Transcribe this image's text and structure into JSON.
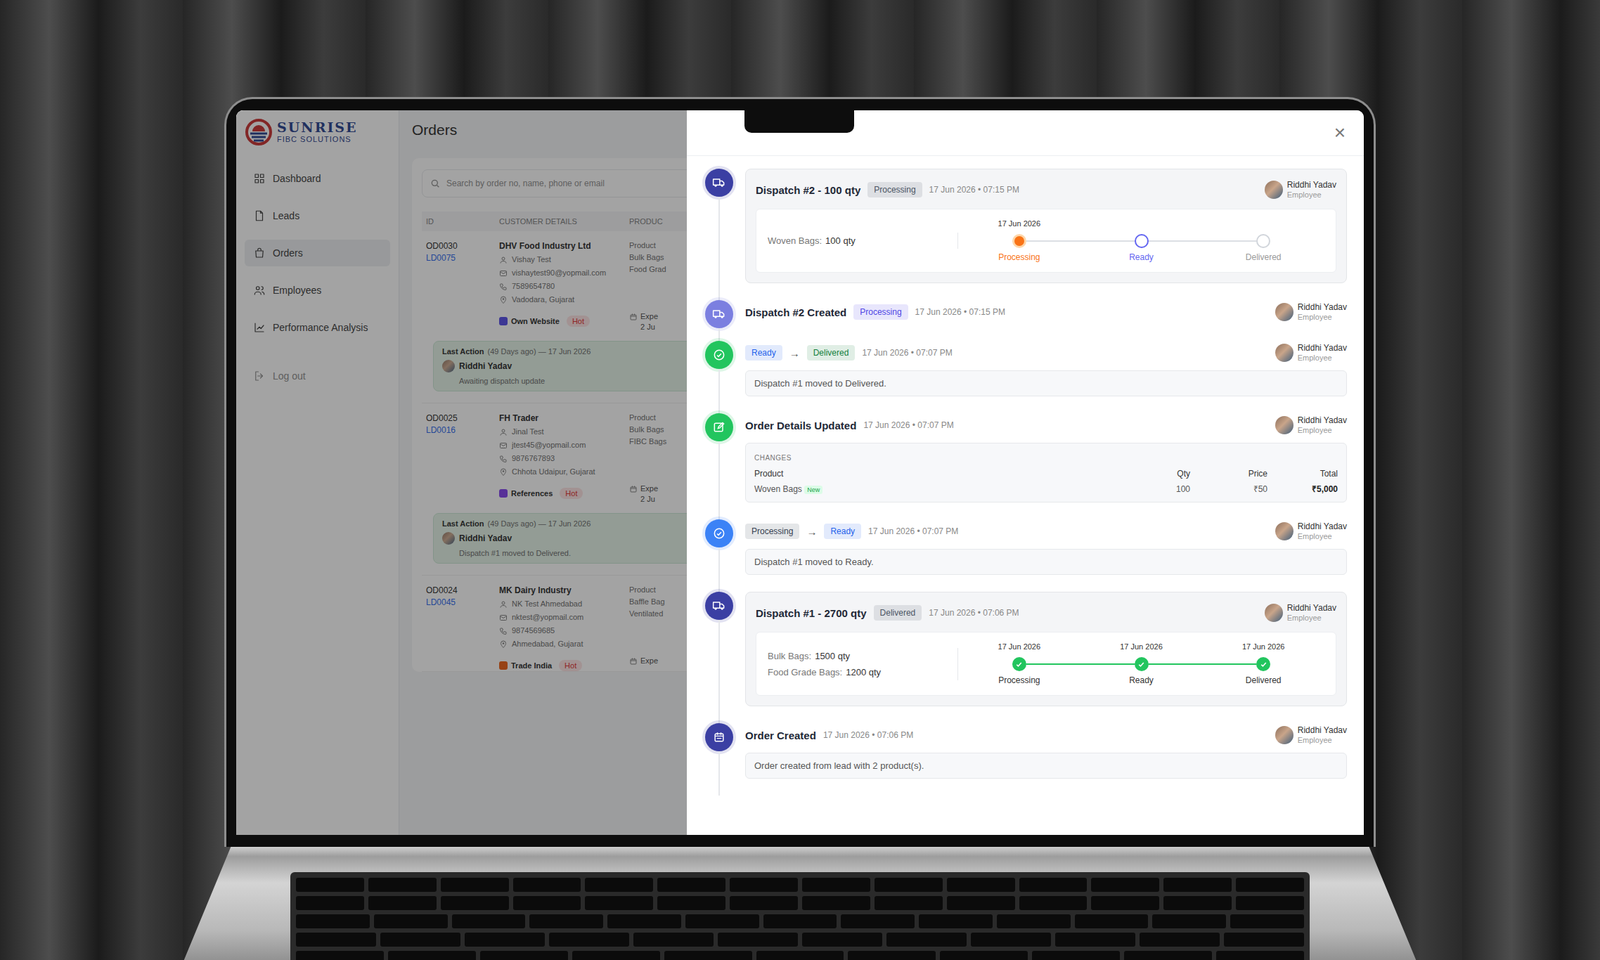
{
  "screen": {
    "sidebar": {
      "logo": {
        "name": "SUNRISE",
        "tagline": "FIBC SOLUTIONS"
      },
      "items": [
        {
          "label": "Dashboard",
          "selected": false,
          "kind": "nav"
        },
        {
          "label": "Leads",
          "selected": false,
          "kind": "nav"
        },
        {
          "label": "Orders",
          "selected": true,
          "kind": "nav"
        },
        {
          "label": "Employees",
          "selected": false,
          "kind": "nav"
        },
        {
          "label": "Performance Analysis",
          "selected": false,
          "kind": "nav"
        },
        {
          "label": "Log out",
          "selected": false,
          "kind": "action"
        }
      ]
    },
    "page": {
      "title": "Orders",
      "search": {
        "placeholder": "Search by order no, name, phone or email"
      },
      "table": {
        "columns": [
          "ID",
          "CUSTOMER DETAILS",
          "PRODUC"
        ],
        "rows": [
          {
            "id": "OD0030",
            "lead": "LD0075",
            "company": "DHV Food Industry Ltd",
            "contact": "Vishay Test",
            "email": "vishaytest90@yopmail.com",
            "phone": "7589654780",
            "location": "Vadodara, Gujarat",
            "source": {
              "label": "Own Website",
              "color": "#4f46e5"
            },
            "priority": "Hot",
            "product_label": "Product",
            "products": [
              "Bulk Bags",
              "Food Grad"
            ],
            "expected": [
              "Expe",
              "2 Ju"
            ],
            "last_action": {
              "label": "Last Action",
              "age": "(49 Days ago) — 17 Jun 2026",
              "user": "Riddhi Yadav",
              "note": "Awaiting dispatch update"
            }
          },
          {
            "id": "OD0025",
            "lead": "LD0016",
            "company": "FH Trader",
            "contact": "Jinal Test",
            "email": "jtest45@yopmail.com",
            "phone": "9876767893",
            "location": "Chhota Udaipur, Gujarat",
            "source": {
              "label": "References",
              "color": "#7c3aed"
            },
            "priority": "Hot",
            "product_label": "Product",
            "products": [
              "Bulk Bags",
              "FIBC Bags"
            ],
            "expected": [
              "Expe",
              "2 Ju"
            ],
            "last_action": {
              "label": "Last Action",
              "age": "(49 Days ago) — 17 Jun 2026",
              "user": "Riddhi Yadav",
              "note": "Dispatch #1 moved to Delivered."
            }
          },
          {
            "id": "OD0024",
            "lead": "LD0045",
            "company": "MK Dairy Industry",
            "contact": "NK Test Ahmedabad",
            "email": "nktest@yopmail.com",
            "phone": "9874569685",
            "location": "Ahmedabad, Gujarat",
            "source": {
              "label": "Trade India",
              "color": "#ea580c"
            },
            "priority": "Hot",
            "product_label": "Product",
            "products": [
              "Baffle Bag",
              "Ventilated"
            ],
            "expected": [
              "Expe"
            ]
          }
        ]
      }
    },
    "drawer": {
      "close": "×",
      "timeline": [
        {
          "kind": "dispatch",
          "color": "#3b3fa3",
          "title": "Dispatch #2 - 100 qty",
          "badge": {
            "label": "Processing",
            "color": "#4b5563"
          },
          "time": "17 Jun 2026 • 07:15 PM",
          "user": {
            "name": "Riddhi Yadav",
            "role": "Employee"
          },
          "items": [
            {
              "name": "Woven Bags:",
              "qty": "100 qty"
            }
          ],
          "steps": [
            {
              "label": "Processing",
              "date": "17 Jun 2026",
              "state": "current"
            },
            {
              "label": "Ready",
              "state": "next"
            },
            {
              "label": "Delivered",
              "state": "pending"
            }
          ]
        },
        {
          "kind": "created",
          "color": "#7b7fe0",
          "title": "Dispatch #2 Created",
          "badge": {
            "label": "Processing",
            "color": "#4f46e5"
          },
          "time": "17 Jun 2026 • 07:15 PM",
          "user": {
            "name": "Riddhi Yadav",
            "role": "Employee"
          }
        },
        {
          "kind": "status",
          "color": "#22c55e",
          "from": {
            "label": "Ready",
            "color": "#2563eb"
          },
          "arrow": "→",
          "to": {
            "label": "Delivered",
            "color": "#15803d"
          },
          "time": "17 Jun 2026 • 07:07 PM",
          "user": {
            "name": "Riddhi Yadav",
            "role": "Employee"
          },
          "note": "Dispatch #1 moved to Delivered."
        },
        {
          "kind": "changes",
          "color": "#22c55e",
          "title": "Order Details Updated",
          "time": "17 Jun 2026 • 07:07 PM",
          "user": {
            "name": "Riddhi Yadav",
            "role": "Employee"
          },
          "changes": {
            "label": "CHANGES",
            "columns": [
              "Product",
              "Qty",
              "Price",
              "Total"
            ],
            "rows": [
              {
                "product": "Woven Bags",
                "tag": "New",
                "qty": "100",
                "price": "₹50",
                "total": "₹5,000"
              }
            ]
          }
        },
        {
          "kind": "status",
          "color": "#3b82f6",
          "from": {
            "label": "Processing",
            "color": "#374151"
          },
          "arrow": "→",
          "to": {
            "label": "Ready",
            "color": "#2563eb"
          },
          "time": "17 Jun 2026 • 07:07 PM",
          "user": {
            "name": "Riddhi Yadav",
            "role": "Employee"
          },
          "note": "Dispatch #1 moved to Ready."
        },
        {
          "kind": "dispatch",
          "color": "#3b3fa3",
          "title": "Dispatch #1 - 2700 qty",
          "badge": {
            "label": "Delivered",
            "color": "#4b5563"
          },
          "time": "17 Jun 2026 • 07:06 PM",
          "user": {
            "name": "Riddhi Yadav",
            "role": "Employee"
          },
          "items": [
            {
              "name": "Bulk Bags:",
              "qty": "1500 qty"
            },
            {
              "name": "Food Grade Bags:",
              "qty": "1200 qty"
            }
          ],
          "steps": [
            {
              "label": "Processing",
              "date": "17 Jun 2026",
              "state": "done"
            },
            {
              "label": "Ready",
              "date": "17 Jun 2026",
              "state": "done"
            },
            {
              "label": "Delivered",
              "date": "17 Jun 2026",
              "state": "done"
            }
          ]
        },
        {
          "kind": "order",
          "color": "#3b3fa3",
          "title": "Order Created",
          "time": "17 Jun 2026 • 07:06 PM",
          "user": {
            "name": "Riddhi Yadav",
            "role": "Employee"
          },
          "note": "Order created from lead with 2 product(s)."
        }
      ]
    }
  }
}
